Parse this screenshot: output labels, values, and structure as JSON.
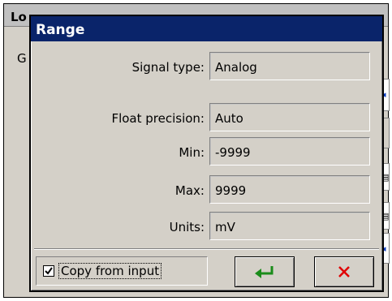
{
  "background_window": {
    "title_fragment": "Lo",
    "label_fragment": "G"
  },
  "dialog": {
    "title": "Range",
    "fields": {
      "signal_type": {
        "label": "Signal type:",
        "value": "Analog"
      },
      "float_precision": {
        "label": "Float precision:",
        "value": "Auto"
      },
      "min": {
        "label": "Min:",
        "value": "-9999"
      },
      "max": {
        "label": "Max:",
        "value": "9999"
      },
      "units": {
        "label": "Units:",
        "value": "mV"
      }
    },
    "copy_from_input": {
      "label": "Copy from input",
      "checked": true
    },
    "buttons": {
      "ok_icon": "enter-arrow-icon",
      "cancel_icon": "close-x-icon"
    }
  },
  "colors": {
    "title_bar": "#0a246a",
    "ok_icon": "#1a8c1a",
    "cancel_icon": "#e00000",
    "face": "#d4d0c8"
  }
}
